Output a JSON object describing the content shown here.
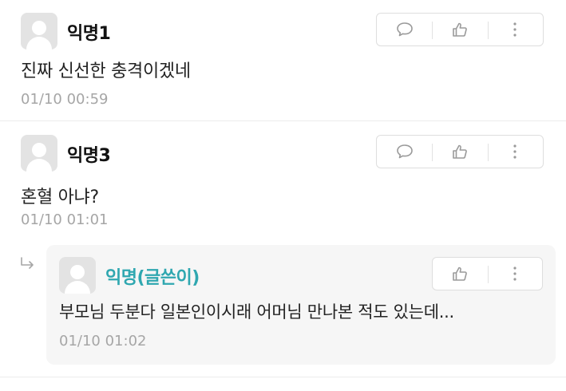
{
  "comments": [
    {
      "nickname": "익명1",
      "text": "진짜 신선한 충격이겠네",
      "time": "01/10 00:59"
    },
    {
      "nickname": "익명3",
      "text": "혼혈 아냐?",
      "time": "01/10 01:01",
      "reply": {
        "nickname": "익명(글쓴이)",
        "text": "부모님 두분다 일본인이시래 어머님 만나본 적도 있는데...",
        "time": "01/10 01:02"
      }
    }
  ],
  "icons": {
    "comment": "speech-bubble-icon",
    "like": "thumbs-up-icon",
    "more": "vertical-ellipsis-icon",
    "reply": "reply-arrow-icon",
    "avatar": "default-profile-icon"
  },
  "colors": {
    "author_accent": "#2fa7b0",
    "timestamp": "#a6a6a6",
    "reply_background": "#f6f6f6"
  }
}
